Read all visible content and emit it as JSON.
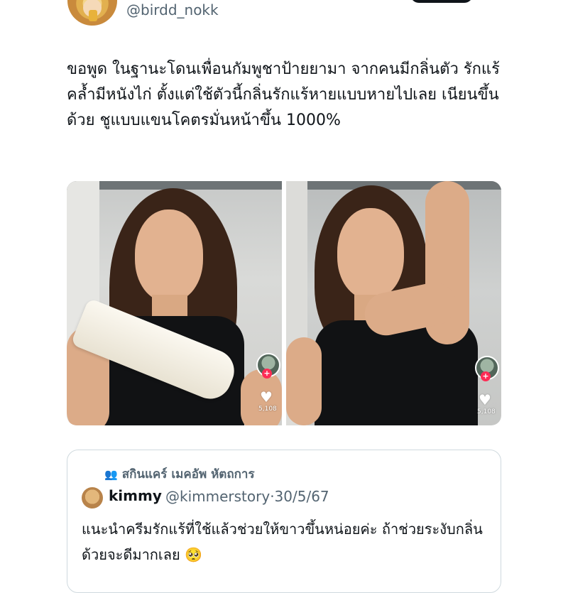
{
  "tweet": {
    "handle": "@birdd_nokk",
    "text": "ขอพูด ในฐานะโดนเพื่อนกัมพูชาป้ายยามา จากคนมีกลิ่นตัว รักแร้คล้ำมีหนังไก่ ตั้งแต่ใช้ตัวนี้กลิ่นรักแร้หายแบบหายไปเลย เนียนขึ้นด้วย ชูแบบแขนโคตรมั่นหน้าขึ้น 1000%",
    "media": [
      {
        "like_count": "5,108"
      },
      {
        "like_count": "5,108"
      }
    ]
  },
  "quote": {
    "community_icon": "community-icon",
    "community": "สกินแคร์ เมคอัพ หัตถการ",
    "author_name": "kimmy",
    "author_handle": "@kimmerstory",
    "separator": "·",
    "date": "30/5/67",
    "text": "แนะนำครีมรักแร้ที่ใช้แล้วช่วยให้ขาวขึ้นหน่อยค่ะ ถ้าช่วยระงับกลิ่นด้วยจะดีมากเลย 🥺"
  },
  "colors": {
    "text": "#0f1419",
    "secondary_text": "#536471",
    "border": "#cfd9de",
    "tiktok_red": "#fe2c55"
  }
}
